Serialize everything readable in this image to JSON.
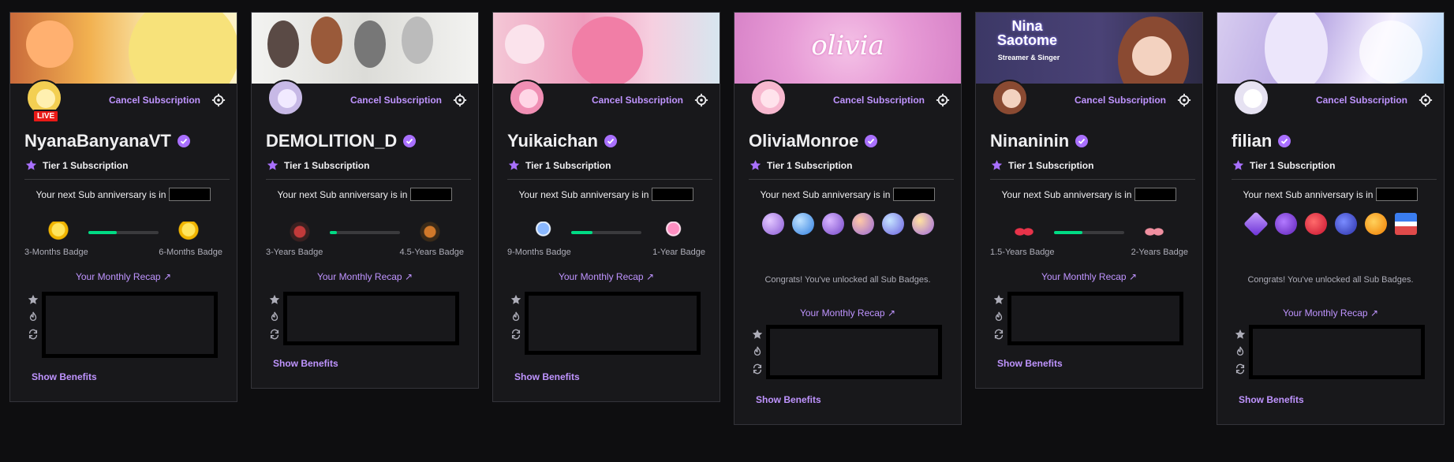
{
  "cards": [
    {
      "name": "NyanaBanyanaVT",
      "live_label": "LIVE",
      "cancel_label": "Cancel Subscription",
      "tier": "Tier 1 Subscription",
      "anniversary_text": "Your next Sub anniversary is in",
      "current_badge_label": "3-Months Badge",
      "next_badge_label": "6-Months Badge",
      "progress": 0.4,
      "recap_label": "Your Monthly Recap ↗",
      "show_benefits_label": "Show Benefits",
      "banner_color": "#e8c56a",
      "badge_icon": "banana-icon"
    },
    {
      "name": "DEMOLITION_D",
      "cancel_label": "Cancel Subscription",
      "tier": "Tier 1 Subscription",
      "anniversary_text": "Your next Sub anniversary is in",
      "current_badge_label": "3-Years Badge",
      "next_badge_label": "4.5-Years Badge",
      "progress": 0.1,
      "recap_label": "Your Monthly Recap ↗",
      "show_benefits_label": "Show Benefits",
      "banner_color": "#e9e9e6",
      "badge_icon": "rune-icon"
    },
    {
      "name": "Yuikaichan",
      "cancel_label": "Cancel Subscription",
      "tier": "Tier 1 Subscription",
      "anniversary_text": "Your next Sub anniversary is in",
      "current_badge_label": "9-Months Badge",
      "next_badge_label": "1-Year Badge",
      "progress": 0.3,
      "recap_label": "Your Monthly Recap ↗",
      "show_benefits_label": "Show Benefits",
      "banner_color": "#f1b3c9",
      "badge_icon": "lollipop-icon"
    },
    {
      "name": "OliviaMonroe",
      "cancel_label": "Cancel Subscription",
      "tier": "Tier 1 Subscription",
      "anniversary_text": "Your next Sub anniversary is in",
      "unlocked_text": "Congrats! You've unlocked all Sub Badges.",
      "recap_label": "Your Monthly Recap ↗",
      "show_benefits_label": "Show Benefits",
      "banner_color": "#e59ad2",
      "banner_text": "olivia",
      "badge_icons": [
        "planet-icon",
        "planet-icon",
        "planet-icon",
        "planet-icon",
        "planet-icon",
        "planet-icon"
      ]
    },
    {
      "name": "Ninaninin",
      "cancel_label": "Cancel Subscription",
      "tier": "Tier 1 Subscription",
      "anniversary_text": "Your next Sub anniversary is in",
      "current_badge_label": "1.5-Years Badge",
      "next_badge_label": "2-Years Badge",
      "progress": 0.4,
      "recap_label": "Your Monthly Recap ↗",
      "show_benefits_label": "Show Benefits",
      "banner_color": "#3b3560",
      "banner_text": "Nina Saotome",
      "banner_subtext": "Streamer & Singer",
      "badge_icon": "bow-icon"
    },
    {
      "name": "filian",
      "cancel_label": "Cancel Subscription",
      "tier": "Tier 1 Subscription",
      "anniversary_text": "Your next Sub anniversary is in",
      "unlocked_text": "Congrats! You've unlocked all Sub Badges.",
      "recap_label": "Your Monthly Recap ↗",
      "show_benefits_label": "Show Benefits",
      "banner_color": "#c9b9e8",
      "badge_icons": [
        "gem-icon",
        "grape-icon",
        "strawberry-icon",
        "blueberry-icon",
        "orange-icon",
        "snack-icon"
      ]
    }
  ],
  "colors": {
    "accent": "#bf94ff",
    "verified": "#a970ff",
    "progress": "#00db84",
    "live": "#e91916"
  }
}
